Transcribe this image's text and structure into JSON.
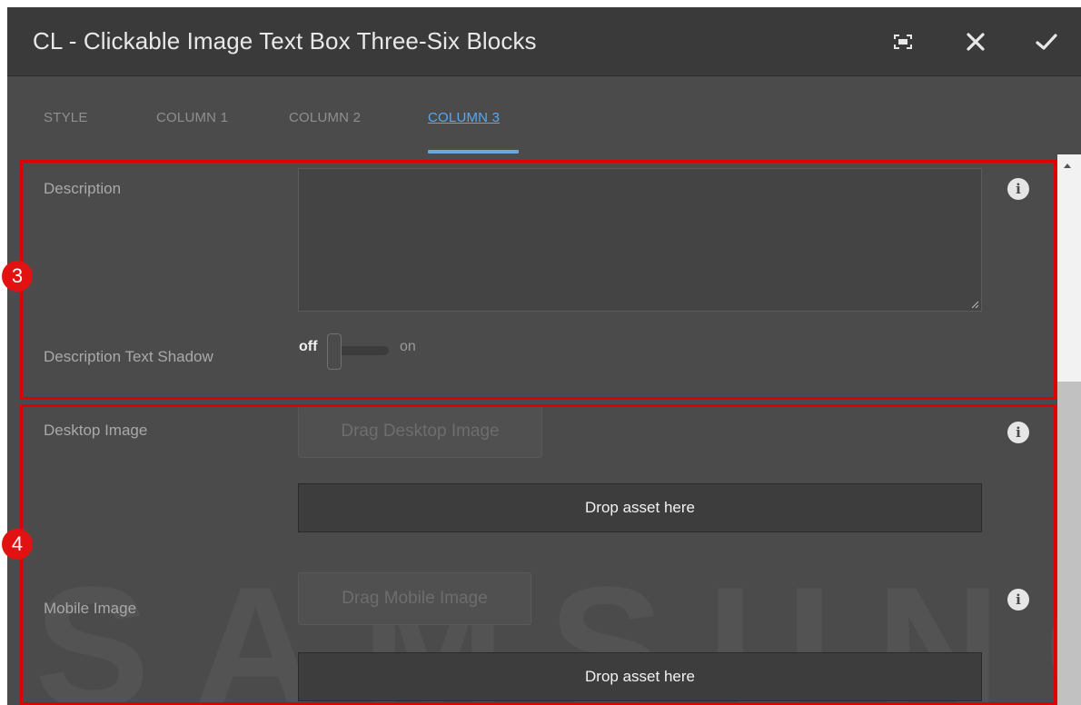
{
  "dialog": {
    "title": "CL - Clickable Image Text Box Three-Six Blocks",
    "icons": {
      "fullscreen": "fullscreen-icon",
      "close": "close-icon",
      "done": "check-icon"
    }
  },
  "tabs": [
    {
      "label": "STYLE",
      "active": false
    },
    {
      "label": "COLUMN 1",
      "active": false
    },
    {
      "label": "COLUMN 2",
      "active": false
    },
    {
      "label": "COLUMN 3",
      "active": true
    }
  ],
  "fields": {
    "description": {
      "label": "Description",
      "value": ""
    },
    "description_text_shadow": {
      "label": "Description Text Shadow",
      "off_label": "off",
      "on_label": "on",
      "state": "off"
    },
    "desktop_image": {
      "label": "Desktop Image",
      "button": "Drag Desktop Image",
      "drop": "Drop asset here"
    },
    "mobile_image": {
      "label": "Mobile Image",
      "button": "Drag Mobile Image",
      "drop": "Drop asset here"
    }
  },
  "annotations": [
    {
      "number": "3",
      "color": "#e00000"
    },
    {
      "number": "4",
      "color": "#e00000"
    }
  ],
  "watermark": "SAMSUNG",
  "colors": {
    "accent": "#5aa7f2",
    "annotation": "#e00000"
  }
}
